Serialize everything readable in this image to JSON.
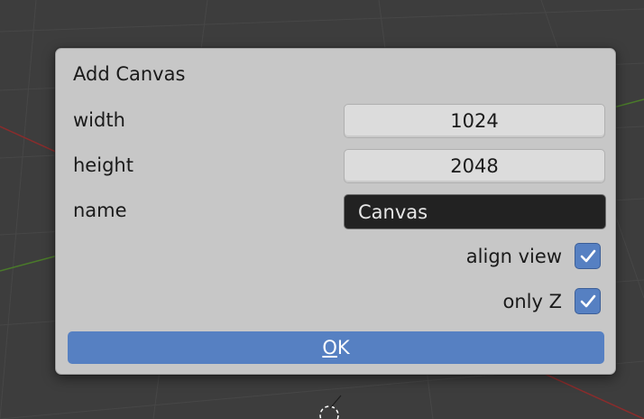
{
  "dialog": {
    "title": "Add Canvas",
    "fields": {
      "width": {
        "label": "width",
        "value": "1024"
      },
      "height": {
        "label": "height",
        "value": "2048"
      },
      "name": {
        "label": "name",
        "value": "Canvas"
      }
    },
    "checkboxes": {
      "align_view": {
        "label": "align view",
        "checked": true
      },
      "only_z": {
        "label": "only Z",
        "checked": true
      }
    },
    "ok_button": {
      "mnemonic": "O",
      "rest": "K"
    }
  },
  "colors": {
    "accent": "#5680c2",
    "dialog_bg": "#c7c7c7",
    "viewport_bg": "#3d3d3d"
  }
}
